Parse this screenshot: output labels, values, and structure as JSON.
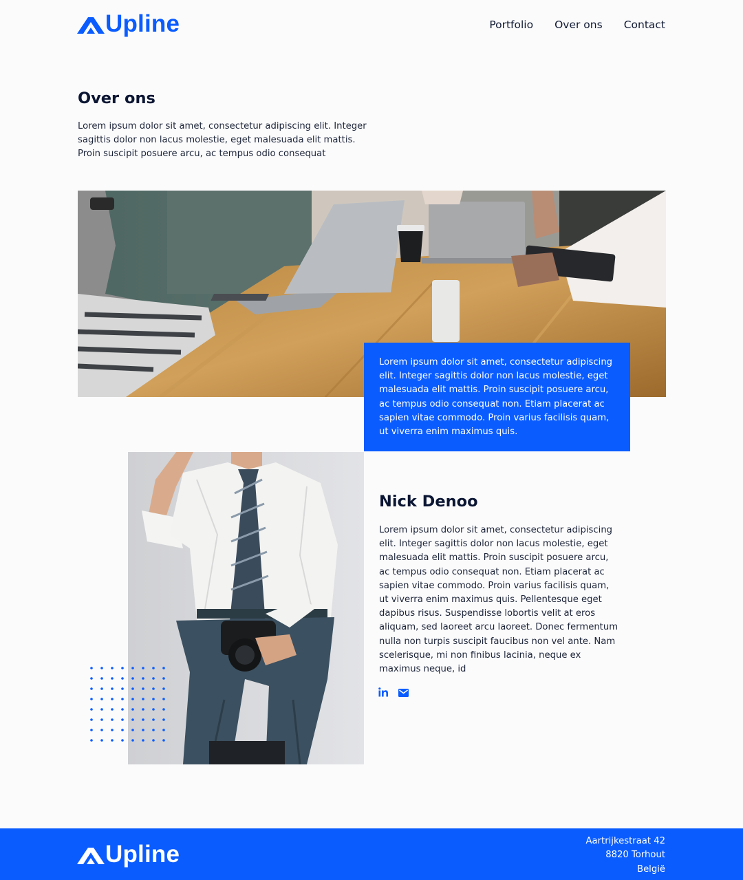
{
  "brand": {
    "name": "Upline",
    "accent": "#0a5cff",
    "ink": "#0b1633"
  },
  "nav": {
    "items": [
      "Portfolio",
      "Over ons",
      "Contact"
    ]
  },
  "intro": {
    "title": "Over ons",
    "text": "Lorem ipsum dolor sit amet, consectetur adipiscing elit. Integer sagittis dolor non lacus molestie, eget malesuada elit mattis. Proin suscipit posuere arcu, ac tempus odio consequat"
  },
  "hero": {
    "card_text": "Lorem ipsum dolor sit amet, consectetur adipiscing elit. Integer sagittis dolor non lacus molestie, eget malesuada elit mattis. Proin suscipit posuere arcu, ac tempus odio consequat non. Etiam placerat ac sapien vitae commodo. Proin varius facilisis quam, ut viverra enim maximus quis."
  },
  "person": {
    "name": "Nick Denoo",
    "bio": "Lorem ipsum dolor sit amet, consectetur adipiscing elit. Integer sagittis dolor non lacus molestie, eget malesuada elit mattis. Proin suscipit posuere arcu, ac tempus odio consequat non. Etiam placerat ac sapien vitae commodo. Proin varius facilisis quam, ut viverra enim maximus quis. Pellentesque eget dapibus risus. Suspendisse lobortis velit at eros aliquam, sed laoreet arcu laoreet. Donec fermentum nulla non turpis suscipit faucibus non vel ante. Nam scelerisque, mi non finibus lacinia, neque ex maximus neque, id",
    "socials": [
      "linkedin-icon",
      "mail-icon"
    ]
  },
  "footer": {
    "address": {
      "street": "Aartrijkestraat 42",
      "city": "8820 Torhout",
      "country": "België"
    }
  }
}
